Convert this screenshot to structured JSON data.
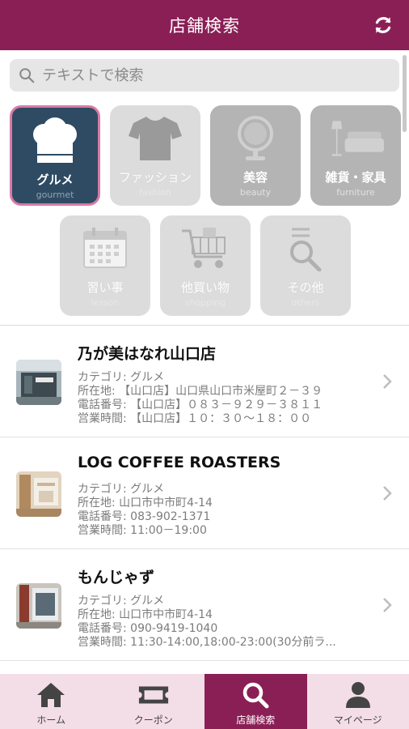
{
  "header": {
    "title": "店舗検索"
  },
  "search": {
    "placeholder": "テキストで検索"
  },
  "categories": [
    {
      "label": "グルメ",
      "sub": "gourmet",
      "icon": "chef-hat-icon",
      "active": true
    },
    {
      "label": "ファッション",
      "sub": "fashion",
      "icon": "tshirt-icon",
      "active": false
    },
    {
      "label": "美容",
      "sub": "beauty",
      "icon": "mirror-icon",
      "active": false
    },
    {
      "label": "雑貨・家具",
      "sub": "furniture",
      "icon": "sofa-lamp-icon",
      "active": false
    },
    {
      "label": "習い事",
      "sub": "lesson",
      "icon": "calendar-icon",
      "active": false
    },
    {
      "label": "他買い物",
      "sub": "shopping",
      "icon": "shopping-cart-icon",
      "active": false
    },
    {
      "label": "その他",
      "sub": "others",
      "icon": "magnifier-icon",
      "active": false
    }
  ],
  "shops": [
    {
      "name": "乃が美はなれ山口店",
      "category": "カテゴリ: グルメ",
      "address": "所在地: 【山口店】山口県山口市米屋町２－３９",
      "phone": "電話番号: 【山口店】０８３－９２９－３８１１",
      "hours": "営業時間: 【山口店】１０：３０～１８：００"
    },
    {
      "name": "LOG COFFEE ROASTERS",
      "category": "カテゴリ: グルメ",
      "address": "所在地: 山口市中市町4-14",
      "phone": "電話番号: 083-902-1371",
      "hours": "営業時間: 11:00－19:00"
    },
    {
      "name": "もんじゃず",
      "category": "カテゴリ: グルメ",
      "address": "所在地: 山口市中市町4-14",
      "phone": "電話番号: 090-9419-1040",
      "hours": "営業時間: 11:30-14:00,18:00-23:00(30分前ラ..."
    }
  ],
  "tabs": [
    {
      "label": "ホーム",
      "icon": "home-icon",
      "active": false
    },
    {
      "label": "クーポン",
      "icon": "ticket-icon",
      "active": false
    },
    {
      "label": "店舗検索",
      "icon": "search-icon",
      "active": true
    },
    {
      "label": "マイページ",
      "icon": "person-icon",
      "active": false
    }
  ],
  "colors": {
    "brand": "#8a1f55",
    "active_category": "#2e4b63",
    "tab_bar": "#f3dde7"
  }
}
